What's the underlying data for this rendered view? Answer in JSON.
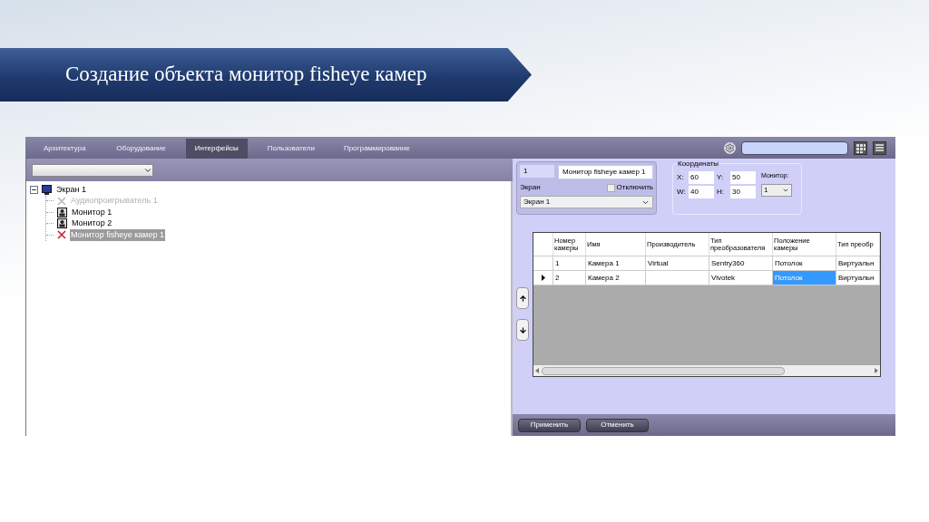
{
  "slide": {
    "title": "Создание объекта монитор fisheye камер"
  },
  "tabs": [
    {
      "label": "Архитектура",
      "selected": false
    },
    {
      "label": "Оборудование",
      "selected": false
    },
    {
      "label": "Интерфейсы",
      "selected": true
    },
    {
      "label": "Пользователи",
      "selected": false
    },
    {
      "label": "Программирование",
      "selected": false
    }
  ],
  "tree": [
    {
      "label": "Экран 1",
      "kind": "screen",
      "expanded": true,
      "selected": false,
      "disabled": false,
      "children": [
        {
          "label": "Аудиопроигрыватель 1",
          "kind": "cross",
          "selected": false,
          "disabled": true
        },
        {
          "label": "Монитор 1",
          "kind": "monitor",
          "selected": false,
          "disabled": false
        },
        {
          "label": "Монитор 2",
          "kind": "monitor",
          "selected": false,
          "disabled": false
        },
        {
          "label": "Монитор fisheye камер 1",
          "kind": "cross",
          "selected": true,
          "disabled": false
        }
      ]
    }
  ],
  "properties": {
    "id": "1",
    "name": "Монитор fisheye камер 1",
    "screen_label": "Экран",
    "disable_checkbox": {
      "label": "Отключить",
      "checked": false
    },
    "screen_select": "Экран 1"
  },
  "coordinates": {
    "title": "Координаты",
    "fields": [
      {
        "label": "X:",
        "value": "60"
      },
      {
        "label": "Y:",
        "value": "50"
      },
      {
        "label": "W:",
        "value": "40"
      },
      {
        "label": "H:",
        "value": "30"
      }
    ],
    "monitor_label": "Монитор:",
    "monitor_select": "1"
  },
  "table": {
    "columns": [
      "Номер камеры",
      "Имя",
      "Производитель",
      "Тип преобразователя",
      "Положение камеры",
      "Тип преобр"
    ],
    "rows": [
      {
        "selected": false,
        "cells": [
          {
            "text": "1",
            "selected": false
          },
          {
            "text": "Камера 1",
            "selected": false
          },
          {
            "text": "Virtual",
            "selected": false
          },
          {
            "text": "Sentry360",
            "selected": false
          },
          {
            "text": "Потолок",
            "selected": false
          },
          {
            "text": "Виртуальн",
            "selected": false
          }
        ]
      },
      {
        "selected": true,
        "cells": [
          {
            "text": "2",
            "selected": false
          },
          {
            "text": "Камера 2",
            "selected": false
          },
          {
            "selected": false
          },
          {
            "text": "Vivotek",
            "selected": false
          },
          {
            "text": "Потолок",
            "selected": true
          },
          {
            "text": "Виртуальн",
            "selected": false
          }
        ]
      }
    ]
  },
  "buttons": [
    "Применить",
    "Отменить"
  ]
}
